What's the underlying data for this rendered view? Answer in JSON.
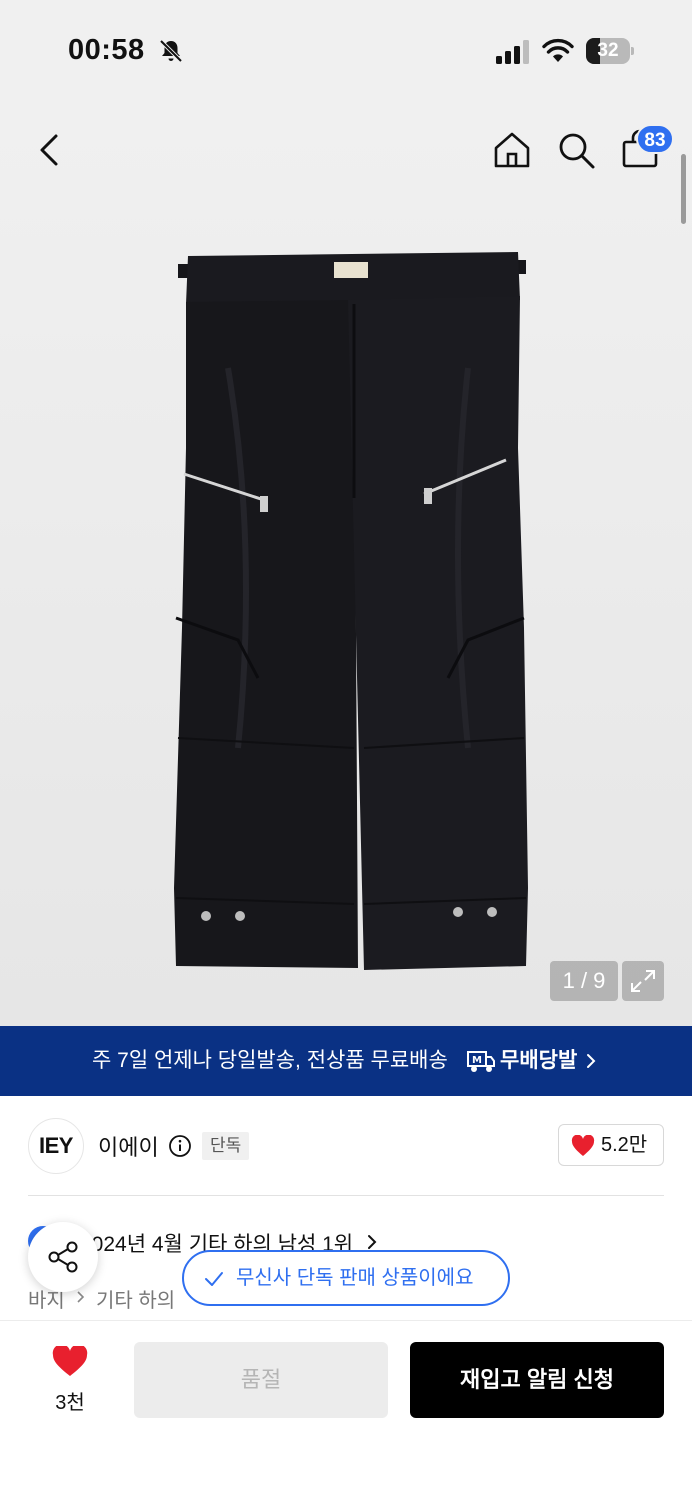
{
  "status_bar": {
    "time": "00:58",
    "battery": "32",
    "battery_percent": 32,
    "icons": [
      "bell-off-icon",
      "signal-icon",
      "wifi-icon",
      "battery-icon"
    ]
  },
  "nav": {
    "icons": [
      "back-icon",
      "home-icon",
      "search-icon",
      "cart-icon"
    ],
    "cart_count": "83"
  },
  "gallery": {
    "counter": "1 / 9",
    "icons": [
      "expand-icon"
    ]
  },
  "banner": {
    "text": "주 7일 언제나 당일발송, 전상품 무료배송",
    "brand": "무배당발"
  },
  "brand": {
    "logo": "IEY",
    "name": "이에이",
    "tag": "단독",
    "likes": "5.2만"
  },
  "ranking": {
    "text": "2024년 4월 기타 하의 남성 1위"
  },
  "breadcrumb": {
    "level1": "바지",
    "level2": "기타 하의"
  },
  "toast": {
    "text": "무신사 단독 판매 상품이에요"
  },
  "bottom": {
    "wish_count": "3천",
    "soldout_label": "품절",
    "restock_label": "재입고 알림 신청"
  },
  "colors": {
    "accent": "#2f6ff0",
    "banner_bg": "#0a3184",
    "heart": "#e8202e"
  }
}
